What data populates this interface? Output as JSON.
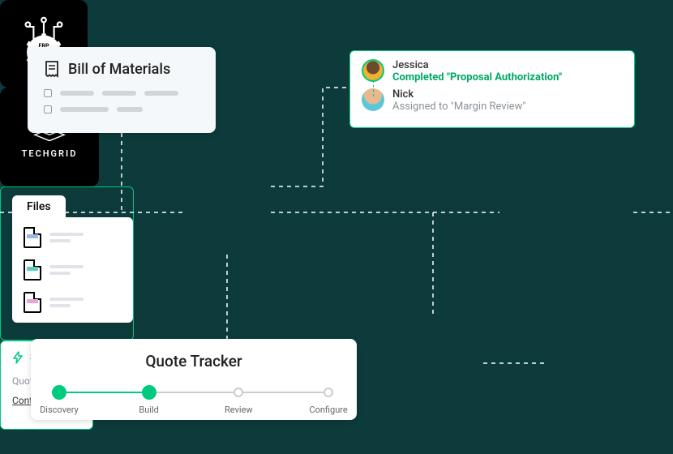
{
  "bom": {
    "title": "Bill of Materials"
  },
  "erp": {
    "label": "ERP"
  },
  "workflow": {
    "user1": {
      "name": "Jessica",
      "status": "Completed \"Proposal Authorization\""
    },
    "user2": {
      "name": "Nick",
      "status": "Assigned to \"Margin Review\""
    }
  },
  "quoteTracker": {
    "title": "Quote Tracker",
    "steps": {
      "s0": "Discovery",
      "s1": "Build",
      "s2": "Review",
      "s3": "Configure"
    }
  },
  "techgrid": {
    "label": "TECHGRID"
  },
  "files": {
    "tab": "Files"
  },
  "sell": {
    "title": "Sell",
    "item1": "Quotes",
    "item2": "Contracts"
  }
}
